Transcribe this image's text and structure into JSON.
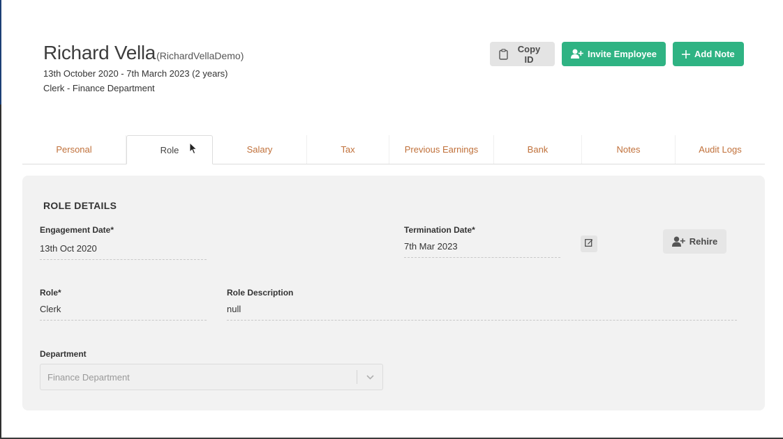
{
  "employee": {
    "name": "Richard Vella",
    "username": "(RichardVellaDemo)",
    "dates": "13th October 2020 - 7th March 2023 (2 years)",
    "position": "Clerk - Finance Department"
  },
  "actions": {
    "copy_id": "Copy ID",
    "invite": "Invite Employee",
    "add_note": "Add Note"
  },
  "tabs": [
    {
      "label": "Personal"
    },
    {
      "label": "Role"
    },
    {
      "label": "Salary"
    },
    {
      "label": "Tax"
    },
    {
      "label": "Previous Earnings"
    },
    {
      "label": "Bank"
    },
    {
      "label": "Notes"
    },
    {
      "label": "Audit Logs"
    }
  ],
  "active_tab": "Role",
  "role_details": {
    "title": "ROLE DETAILS",
    "engagement_label": "Engagement Date*",
    "engagement_value": "13th Oct 2020",
    "termination_label": "Termination Date*",
    "termination_value": "7th Mar 2023",
    "rehire_label": "Rehire",
    "role_label": "Role*",
    "role_value": "Clerk",
    "role_desc_label": "Role Description",
    "role_desc_value": "null",
    "department_label": "Department",
    "department_value": "Finance Department"
  },
  "colors": {
    "accent_green": "#2fb383",
    "tab_link": "#c0703a",
    "panel_bg": "#f2f2f2"
  },
  "icons": {
    "copy": "clipboard-icon",
    "invite": "user-plus-icon",
    "add_note": "plus-icon",
    "edit": "edit-icon",
    "rehire": "user-plus-icon",
    "dropdown": "chevron-down-icon",
    "cursor": "mouse-pointer-icon"
  }
}
